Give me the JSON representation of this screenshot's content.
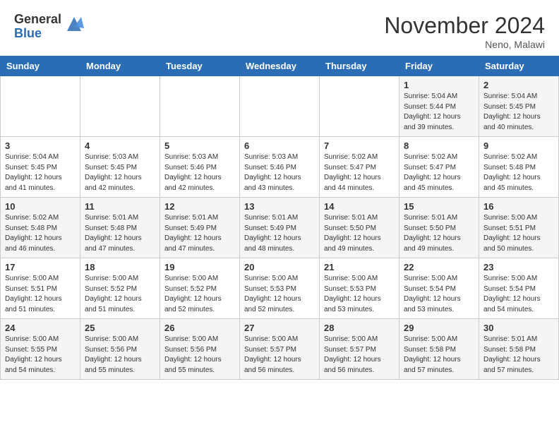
{
  "logo": {
    "general": "General",
    "blue": "Blue"
  },
  "title": "November 2024",
  "location": "Neno, Malawi",
  "days_of_week": [
    "Sunday",
    "Monday",
    "Tuesday",
    "Wednesday",
    "Thursday",
    "Friday",
    "Saturday"
  ],
  "weeks": [
    [
      {
        "day": "",
        "info": ""
      },
      {
        "day": "",
        "info": ""
      },
      {
        "day": "",
        "info": ""
      },
      {
        "day": "",
        "info": ""
      },
      {
        "day": "",
        "info": ""
      },
      {
        "day": "1",
        "info": "Sunrise: 5:04 AM\nSunset: 5:44 PM\nDaylight: 12 hours\nand 39 minutes."
      },
      {
        "day": "2",
        "info": "Sunrise: 5:04 AM\nSunset: 5:45 PM\nDaylight: 12 hours\nand 40 minutes."
      }
    ],
    [
      {
        "day": "3",
        "info": "Sunrise: 5:04 AM\nSunset: 5:45 PM\nDaylight: 12 hours\nand 41 minutes."
      },
      {
        "day": "4",
        "info": "Sunrise: 5:03 AM\nSunset: 5:45 PM\nDaylight: 12 hours\nand 42 minutes."
      },
      {
        "day": "5",
        "info": "Sunrise: 5:03 AM\nSunset: 5:46 PM\nDaylight: 12 hours\nand 42 minutes."
      },
      {
        "day": "6",
        "info": "Sunrise: 5:03 AM\nSunset: 5:46 PM\nDaylight: 12 hours\nand 43 minutes."
      },
      {
        "day": "7",
        "info": "Sunrise: 5:02 AM\nSunset: 5:47 PM\nDaylight: 12 hours\nand 44 minutes."
      },
      {
        "day": "8",
        "info": "Sunrise: 5:02 AM\nSunset: 5:47 PM\nDaylight: 12 hours\nand 45 minutes."
      },
      {
        "day": "9",
        "info": "Sunrise: 5:02 AM\nSunset: 5:48 PM\nDaylight: 12 hours\nand 45 minutes."
      }
    ],
    [
      {
        "day": "10",
        "info": "Sunrise: 5:02 AM\nSunset: 5:48 PM\nDaylight: 12 hours\nand 46 minutes."
      },
      {
        "day": "11",
        "info": "Sunrise: 5:01 AM\nSunset: 5:48 PM\nDaylight: 12 hours\nand 47 minutes."
      },
      {
        "day": "12",
        "info": "Sunrise: 5:01 AM\nSunset: 5:49 PM\nDaylight: 12 hours\nand 47 minutes."
      },
      {
        "day": "13",
        "info": "Sunrise: 5:01 AM\nSunset: 5:49 PM\nDaylight: 12 hours\nand 48 minutes."
      },
      {
        "day": "14",
        "info": "Sunrise: 5:01 AM\nSunset: 5:50 PM\nDaylight: 12 hours\nand 49 minutes."
      },
      {
        "day": "15",
        "info": "Sunrise: 5:01 AM\nSunset: 5:50 PM\nDaylight: 12 hours\nand 49 minutes."
      },
      {
        "day": "16",
        "info": "Sunrise: 5:00 AM\nSunset: 5:51 PM\nDaylight: 12 hours\nand 50 minutes."
      }
    ],
    [
      {
        "day": "17",
        "info": "Sunrise: 5:00 AM\nSunset: 5:51 PM\nDaylight: 12 hours\nand 51 minutes."
      },
      {
        "day": "18",
        "info": "Sunrise: 5:00 AM\nSunset: 5:52 PM\nDaylight: 12 hours\nand 51 minutes."
      },
      {
        "day": "19",
        "info": "Sunrise: 5:00 AM\nSunset: 5:52 PM\nDaylight: 12 hours\nand 52 minutes."
      },
      {
        "day": "20",
        "info": "Sunrise: 5:00 AM\nSunset: 5:53 PM\nDaylight: 12 hours\nand 52 minutes."
      },
      {
        "day": "21",
        "info": "Sunrise: 5:00 AM\nSunset: 5:53 PM\nDaylight: 12 hours\nand 53 minutes."
      },
      {
        "day": "22",
        "info": "Sunrise: 5:00 AM\nSunset: 5:54 PM\nDaylight: 12 hours\nand 53 minutes."
      },
      {
        "day": "23",
        "info": "Sunrise: 5:00 AM\nSunset: 5:54 PM\nDaylight: 12 hours\nand 54 minutes."
      }
    ],
    [
      {
        "day": "24",
        "info": "Sunrise: 5:00 AM\nSunset: 5:55 PM\nDaylight: 12 hours\nand 54 minutes."
      },
      {
        "day": "25",
        "info": "Sunrise: 5:00 AM\nSunset: 5:56 PM\nDaylight: 12 hours\nand 55 minutes."
      },
      {
        "day": "26",
        "info": "Sunrise: 5:00 AM\nSunset: 5:56 PM\nDaylight: 12 hours\nand 55 minutes."
      },
      {
        "day": "27",
        "info": "Sunrise: 5:00 AM\nSunset: 5:57 PM\nDaylight: 12 hours\nand 56 minutes."
      },
      {
        "day": "28",
        "info": "Sunrise: 5:00 AM\nSunset: 5:57 PM\nDaylight: 12 hours\nand 56 minutes."
      },
      {
        "day": "29",
        "info": "Sunrise: 5:00 AM\nSunset: 5:58 PM\nDaylight: 12 hours\nand 57 minutes."
      },
      {
        "day": "30",
        "info": "Sunrise: 5:01 AM\nSunset: 5:58 PM\nDaylight: 12 hours\nand 57 minutes."
      }
    ]
  ]
}
